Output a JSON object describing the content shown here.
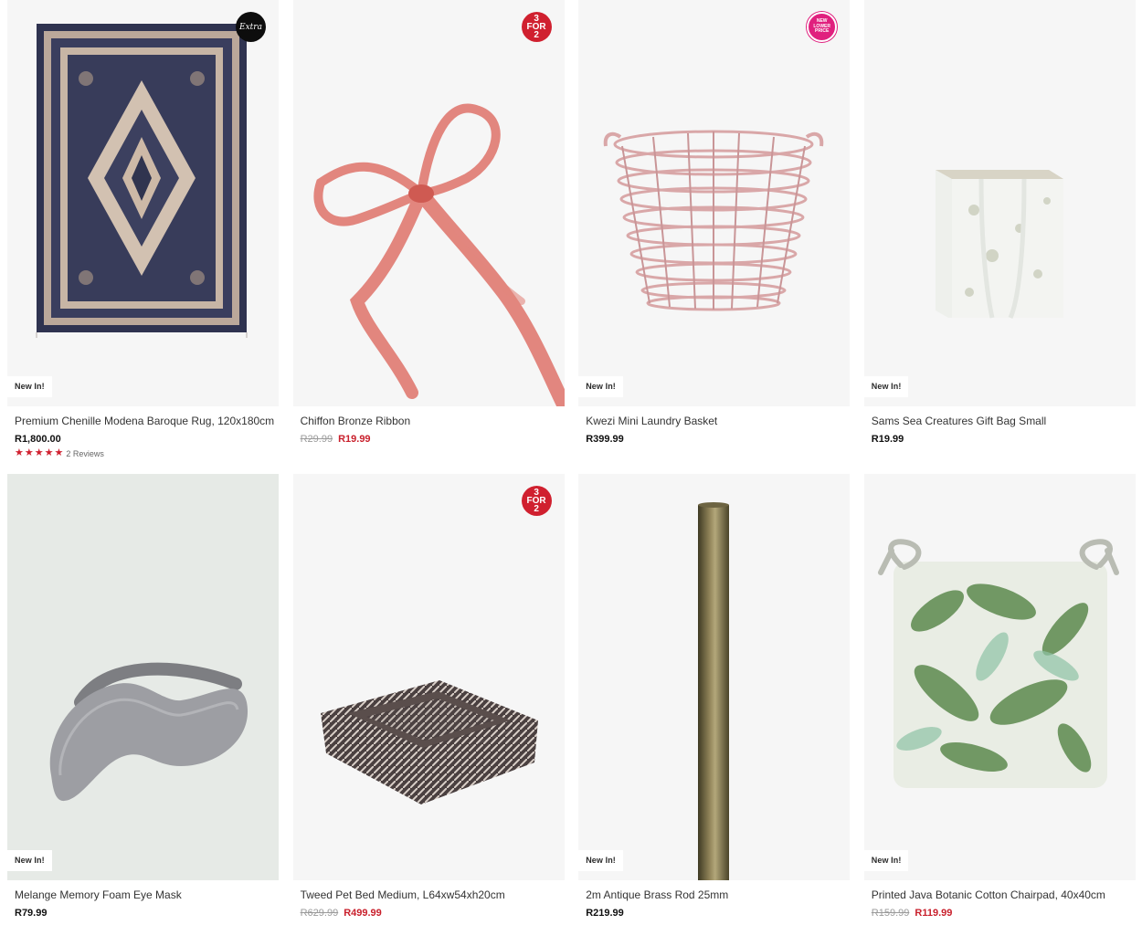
{
  "products": [
    {
      "name": "Premium Chenille Modena Baroque Rug, 120x180cm",
      "price": "R1,800.00",
      "tag": "New In!",
      "badge_text": "Extra",
      "stars": 5,
      "reviews": "2 Reviews"
    },
    {
      "name": "Chiffon Bronze Ribbon",
      "was_price": "R29.99",
      "now_price": "R19.99",
      "badge_lines": [
        "3",
        "FOR",
        "2"
      ]
    },
    {
      "name": "Kwezi Mini Laundry Basket",
      "price": "R399.99",
      "tag": "New In!",
      "badge_lines": [
        "NEW",
        "LOWER",
        "PRICE"
      ]
    },
    {
      "name": "Sams Sea Creatures Gift Bag Small",
      "price": "R19.99",
      "tag": "New In!"
    },
    {
      "name": "Melange Memory Foam Eye Mask",
      "price": "R79.99",
      "tag": "New In!"
    },
    {
      "name": "Tweed Pet Bed Medium, L64xw54xh20cm",
      "was_price": "R629.99",
      "now_price": "R499.99",
      "badge_lines": [
        "3",
        "FOR",
        "2"
      ]
    },
    {
      "name": "2m Antique Brass Rod 25mm",
      "price": "R219.99",
      "tag": "New In!"
    },
    {
      "name": "Printed Java Botanic Cotton Chairpad, 40x40cm",
      "was_price": "R159.99",
      "now_price": "R119.99",
      "tag": "New In!"
    }
  ],
  "colors": {
    "sale": "#c9202c",
    "badge_red": "#d0202f",
    "badge_pink": "#e0207e",
    "image_bg": "#f6f6f6"
  }
}
